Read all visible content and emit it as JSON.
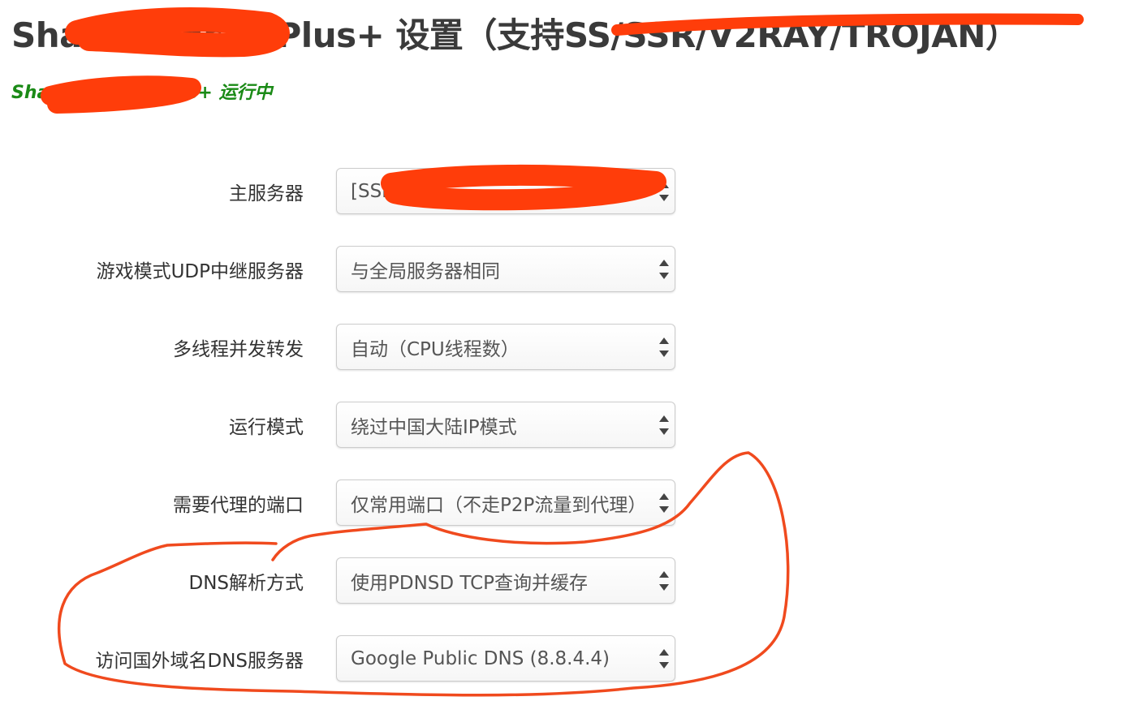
{
  "header": {
    "title": "Shadowsocks Plus+ 设置（支持SS/SSR/V2RAY/TROJAN）",
    "status": "ShadowSocks Plus+ 运行中"
  },
  "form": {
    "rows": [
      {
        "label": "主服务器",
        "value": "[SSR] ..."
      },
      {
        "label": "游戏模式UDP中继服务器",
        "value": "与全局服务器相同"
      },
      {
        "label": "多线程并发转发",
        "value": "自动（CPU线程数）"
      },
      {
        "label": "运行模式",
        "value": "绕过中国大陆IP模式"
      },
      {
        "label": "需要代理的端口",
        "value": "仅常用端口（不走P2P流量到代理）"
      },
      {
        "label": "DNS解析方式",
        "value": "使用PDNSD TCP查询并缓存"
      },
      {
        "label": "访问国外域名DNS服务器",
        "value": "Google Public DNS (8.8.4.4)"
      }
    ]
  },
  "colors": {
    "status_green": "#1a8a16",
    "redaction_marker": "#ff3d0a",
    "annotation_circle": "#f04a1e"
  },
  "icons": {
    "select_arrows": "up-down-chevron-icon"
  }
}
